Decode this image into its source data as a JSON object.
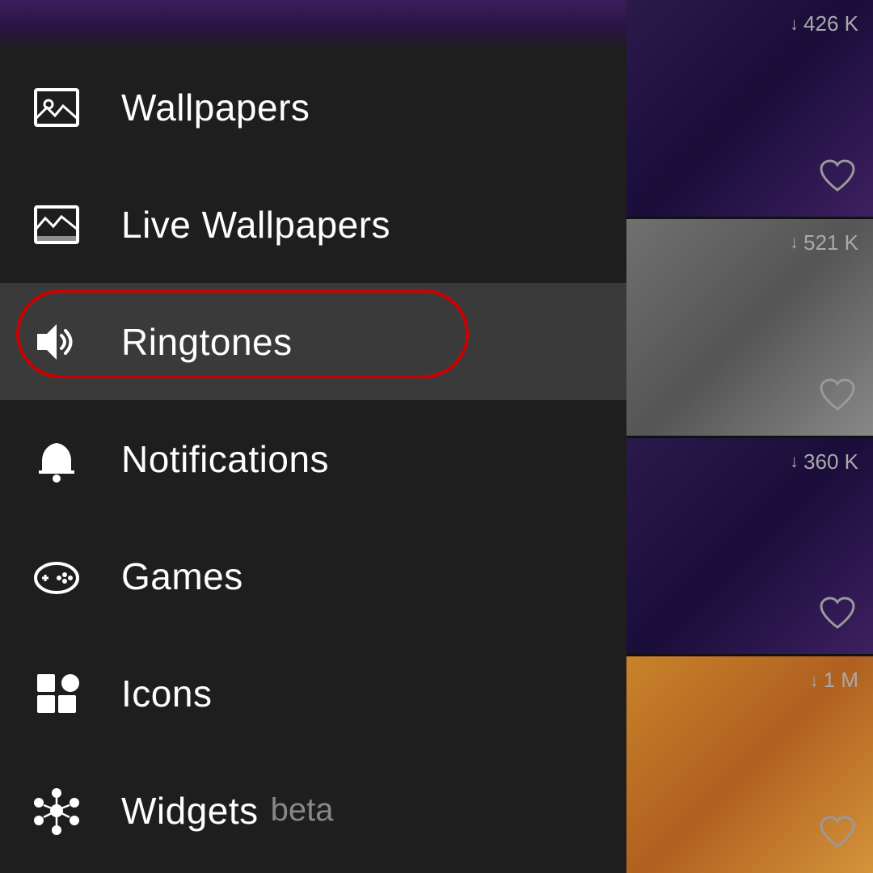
{
  "menu": {
    "items": [
      {
        "id": "wallpapers",
        "label": "Wallpapers",
        "icon": "wallpaper-icon",
        "active": false
      },
      {
        "id": "live-wallpapers",
        "label": "Live Wallpapers",
        "icon": "live-wallpaper-icon",
        "active": false
      },
      {
        "id": "ringtones",
        "label": "Ringtones",
        "icon": "ringtone-icon",
        "active": true
      },
      {
        "id": "notifications",
        "label": "Notifications",
        "icon": "notification-icon",
        "active": false
      },
      {
        "id": "games",
        "label": "Games",
        "icon": "games-icon",
        "active": false
      },
      {
        "id": "icons",
        "label": "Icons",
        "icon": "icons-icon",
        "active": false
      },
      {
        "id": "widgets",
        "label": "Widgets",
        "icon": "widgets-icon",
        "active": false,
        "badge": "beta"
      }
    ]
  },
  "content": {
    "cards": [
      {
        "downloads": "426 K",
        "color": "purple"
      },
      {
        "downloads": "521 K",
        "color": "gray"
      },
      {
        "downloads": "360 K",
        "color": "purple"
      },
      {
        "downloads": "1 M",
        "color": "orange"
      }
    ]
  }
}
